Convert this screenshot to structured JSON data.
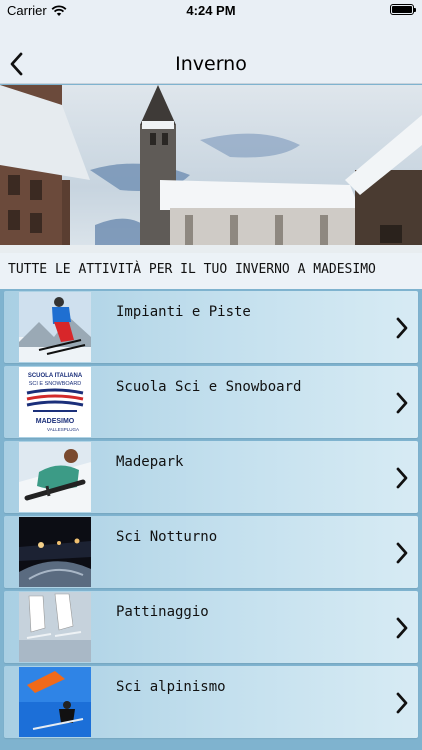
{
  "status_bar": {
    "carrier": "Carrier",
    "time": "4:24 PM"
  },
  "nav": {
    "title": "Inverno",
    "back_icon": "chevron-left-icon"
  },
  "hero": {
    "caption": "TUTTE LE ATTIVITÀ PER IL TUO INVERNO A MADESIMO"
  },
  "items": [
    {
      "label": "Impianti e Piste",
      "thumb": "skier"
    },
    {
      "label": "Scuola Sci e Snowboard",
      "thumb": "ski-school-logo",
      "logo_text": [
        "SCUOLA ITALIANA",
        "SCI E SNOWBOARD",
        "MADESIMO",
        "VALLESPLUGA"
      ]
    },
    {
      "label": "Madepark",
      "thumb": "snowboarder"
    },
    {
      "label": "Sci Notturno",
      "thumb": "night-ski"
    },
    {
      "label": "Pattinaggio",
      "thumb": "skates"
    },
    {
      "label": "Sci alpinismo",
      "thumb": "ski-touring"
    }
  ],
  "colors": {
    "nav_bg": "#e9eff5",
    "list_bg": "#7fb3cf",
    "row_start": "#a9cfe3",
    "row_end": "#d7ebf4"
  }
}
